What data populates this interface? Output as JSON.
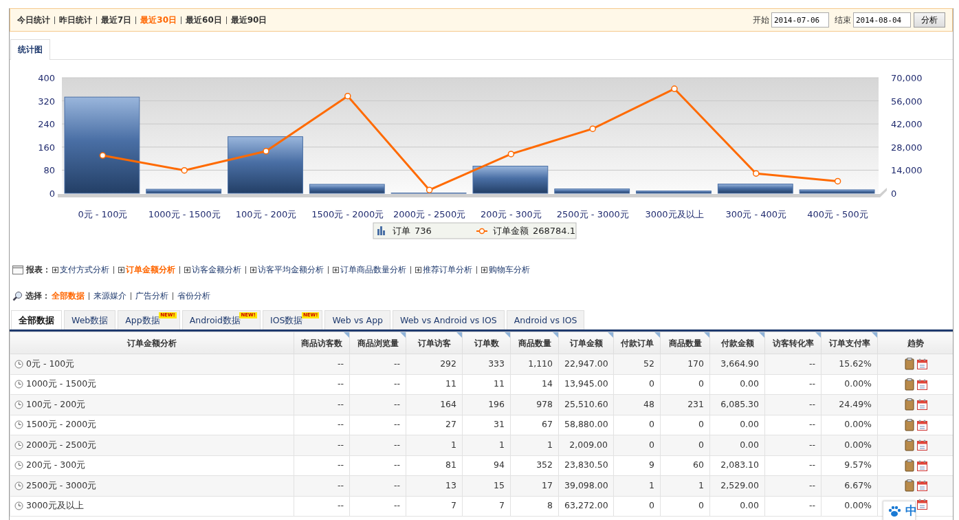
{
  "filter_bar": {
    "ranges": [
      {
        "label": "今日统计",
        "selected": false
      },
      {
        "label": "昨日统计",
        "selected": false
      },
      {
        "label": "最近7日",
        "selected": false
      },
      {
        "label": "最近30日",
        "selected": true
      },
      {
        "label": "最近60日",
        "selected": false
      },
      {
        "label": "最近90日",
        "selected": false
      }
    ],
    "start_label": "开始",
    "start_date": "2014-07-06",
    "end_label": "结束",
    "end_date": "2014-08-04",
    "button": "分析"
  },
  "view_tabs": [
    {
      "label": "统计图",
      "selected": true
    }
  ],
  "chart": {
    "bar_chart": {
      "chart_data": {
        "type": "bar",
        "categories": [
          "0元 - 100元",
          "1000元 - 1500元",
          "100元 - 200元",
          "1500元 - 2000元",
          "2000元 - 2500元",
          "200元 - 300元",
          "2500元 - 3000元",
          "3000元及以上",
          "300元 - 400元",
          "400元 - 500元"
        ],
        "series": [
          {
            "name": "订单",
            "color": "#4a6fa5",
            "values": [
              333,
              14,
              196,
              31,
              1,
              94,
              15,
              8,
              32,
              12
            ]
          }
        ],
        "ylim": [
          0,
          400
        ],
        "yticks": [
          0,
          80,
          160,
          240,
          320,
          400
        ],
        "grid": true
      },
      "legend_total": "736"
    },
    "line_chart": {
      "chart_data": {
        "type": "line",
        "series": [
          {
            "name": "订单金额",
            "color": "#ff6a00",
            "marker": "o",
            "values": [
              22900,
              13900,
              25500,
              58900,
              2000,
              23800,
              39100,
              63300,
              12000,
              7300
            ]
          }
        ],
        "ylim": [
          0,
          70000
        ],
        "yticks": [
          {
            "value": 0,
            "label": "0"
          },
          {
            "value": 14000,
            "label": "14,000"
          },
          {
            "value": 28000,
            "label": "28,000"
          },
          {
            "value": 42000,
            "label": "42,000"
          },
          {
            "value": 56000,
            "label": "56,000"
          },
          {
            "value": 70000,
            "label": "70,000"
          }
        ]
      },
      "legend_total": "268784.1"
    }
  },
  "report_links": {
    "label": "报表：",
    "items": [
      {
        "label": "支付方式分析",
        "selected": false
      },
      {
        "label": "订单金额分析",
        "selected": true
      },
      {
        "label": "访客金额分析",
        "selected": false
      },
      {
        "label": "访客平均金额分析",
        "selected": false
      },
      {
        "label": "订单商品数量分析",
        "selected": false
      },
      {
        "label": "推荐订单分析",
        "selected": false
      },
      {
        "label": "购物车分析",
        "selected": false
      }
    ]
  },
  "select_links": {
    "label": "选择：",
    "items": [
      {
        "label": "全部数据",
        "selected": true
      },
      {
        "label": "来源媒介",
        "selected": false
      },
      {
        "label": "广告分析",
        "selected": false
      },
      {
        "label": "省份分析",
        "selected": false
      }
    ]
  },
  "data_tabs": [
    {
      "label": "全部数据",
      "selected": true
    },
    {
      "label": "Web数据",
      "selected": false
    },
    {
      "label": "App数据",
      "selected": false,
      "badge": "NEW!"
    },
    {
      "label": "Android数据",
      "selected": false,
      "badge": "NEW!"
    },
    {
      "label": "IOS数据",
      "selected": false,
      "badge": "NEW!"
    },
    {
      "label": "Web vs App",
      "selected": false
    },
    {
      "label": "Web vs Android vs IOS",
      "selected": false
    },
    {
      "label": "Android vs IOS",
      "selected": false
    }
  ],
  "table": {
    "columns": [
      {
        "label": "订单金额分析",
        "sortable": false
      },
      {
        "label": "商品访客数",
        "sortable": true
      },
      {
        "label": "商品浏览量",
        "sortable": true
      },
      {
        "label": "订单访客",
        "sortable": true
      },
      {
        "label": "订单数",
        "sortable": true
      },
      {
        "label": "商品数量",
        "sortable": true
      },
      {
        "label": "订单金额",
        "sortable": true
      },
      {
        "label": "付款订单",
        "sortable": true
      },
      {
        "label": "商品数量",
        "sortable": true
      },
      {
        "label": "付款金额",
        "sortable": true
      },
      {
        "label": "访客转化率",
        "sortable": true
      },
      {
        "label": "订单支付率",
        "sortable": true
      },
      {
        "label": "趋势",
        "sortable": false
      }
    ],
    "rows": [
      {
        "cells": [
          "0元 - 100元",
          "--",
          "--",
          "292",
          "333",
          "1,110",
          "22,947.00",
          "52",
          "170",
          "3,664.90",
          "--",
          "15.62%"
        ]
      },
      {
        "cells": [
          "1000元 - 1500元",
          "--",
          "--",
          "11",
          "11",
          "14",
          "13,945.00",
          "0",
          "0",
          "0.00",
          "--",
          "0.00%"
        ]
      },
      {
        "cells": [
          "100元 - 200元",
          "--",
          "--",
          "164",
          "196",
          "978",
          "25,510.60",
          "48",
          "231",
          "6,085.30",
          "--",
          "24.49%"
        ]
      },
      {
        "cells": [
          "1500元 - 2000元",
          "--",
          "--",
          "27",
          "31",
          "67",
          "58,880.00",
          "0",
          "0",
          "0.00",
          "--",
          "0.00%"
        ]
      },
      {
        "cells": [
          "2000元 - 2500元",
          "--",
          "--",
          "1",
          "1",
          "1",
          "2,009.00",
          "0",
          "0",
          "0.00",
          "--",
          "0.00%"
        ]
      },
      {
        "cells": [
          "200元 - 300元",
          "--",
          "--",
          "81",
          "94",
          "352",
          "23,830.50",
          "9",
          "60",
          "2,083.10",
          "--",
          "9.57%"
        ]
      },
      {
        "cells": [
          "2500元 - 3000元",
          "--",
          "--",
          "13",
          "15",
          "17",
          "39,098.00",
          "1",
          "1",
          "2,529.00",
          "--",
          "6.67%"
        ]
      },
      {
        "cells": [
          "3000元及以上",
          "--",
          "--",
          "7",
          "7",
          "8",
          "63,272.00",
          "0",
          "0",
          "0.00",
          "--",
          "0.00%"
        ]
      }
    ]
  },
  "ime_indicator": {
    "label": "中"
  }
}
